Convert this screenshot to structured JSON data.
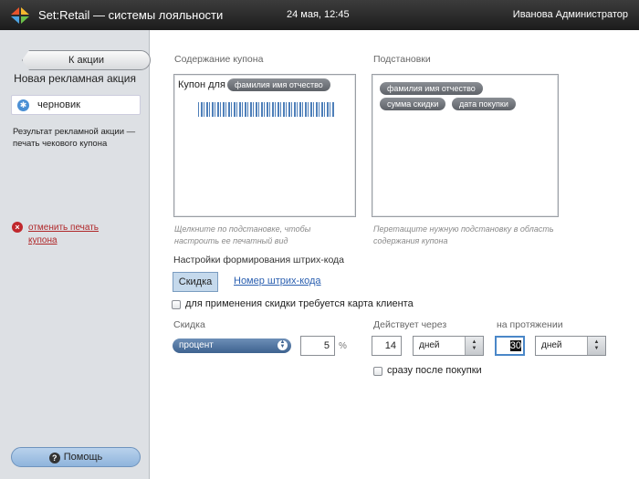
{
  "header": {
    "app_title": "Set:Retail — системы лояльности",
    "datetime": "24 мая, 12:45",
    "user": "Иванова Администратор"
  },
  "sidebar": {
    "back_label": "К акции",
    "promo_title": "Новая рекламная акция",
    "status": "черновик",
    "result_text": "Результат рекламной акции — печать чекового купона",
    "cancel_label": "отменить печать купона",
    "help_label": "Помощь"
  },
  "coupon": {
    "section_label": "Содержание купона",
    "text_prefix": "Купон для",
    "chip": "фамилия имя отчество",
    "hint": "Щелкните по подстановке, чтобы настроить ее печатный вид"
  },
  "substitutions": {
    "section_label": "Подстановки",
    "chips": [
      "фамилия имя отчество",
      "сумма скидки",
      "дата покупки"
    ],
    "hint": "Перетащите нужную подстановку в область содержания купона"
  },
  "barcode": {
    "section_label": "Настройки формирования штрих-кода",
    "tab_active": "Скидка",
    "tab_link": "Номер штрих-кода"
  },
  "card_required": {
    "label": "для применения скидки требуется карта клиента",
    "checked": false
  },
  "discount": {
    "label": "Скидка",
    "type": "процент",
    "value": "5",
    "unit": "%"
  },
  "validity": {
    "after_label": "Действует через",
    "after_value": "14",
    "after_unit": "дней",
    "duration_label": "на протяжении",
    "duration_value": "30",
    "duration_unit": "дней",
    "immediate_label": "сразу после покупки",
    "immediate_checked": false
  }
}
